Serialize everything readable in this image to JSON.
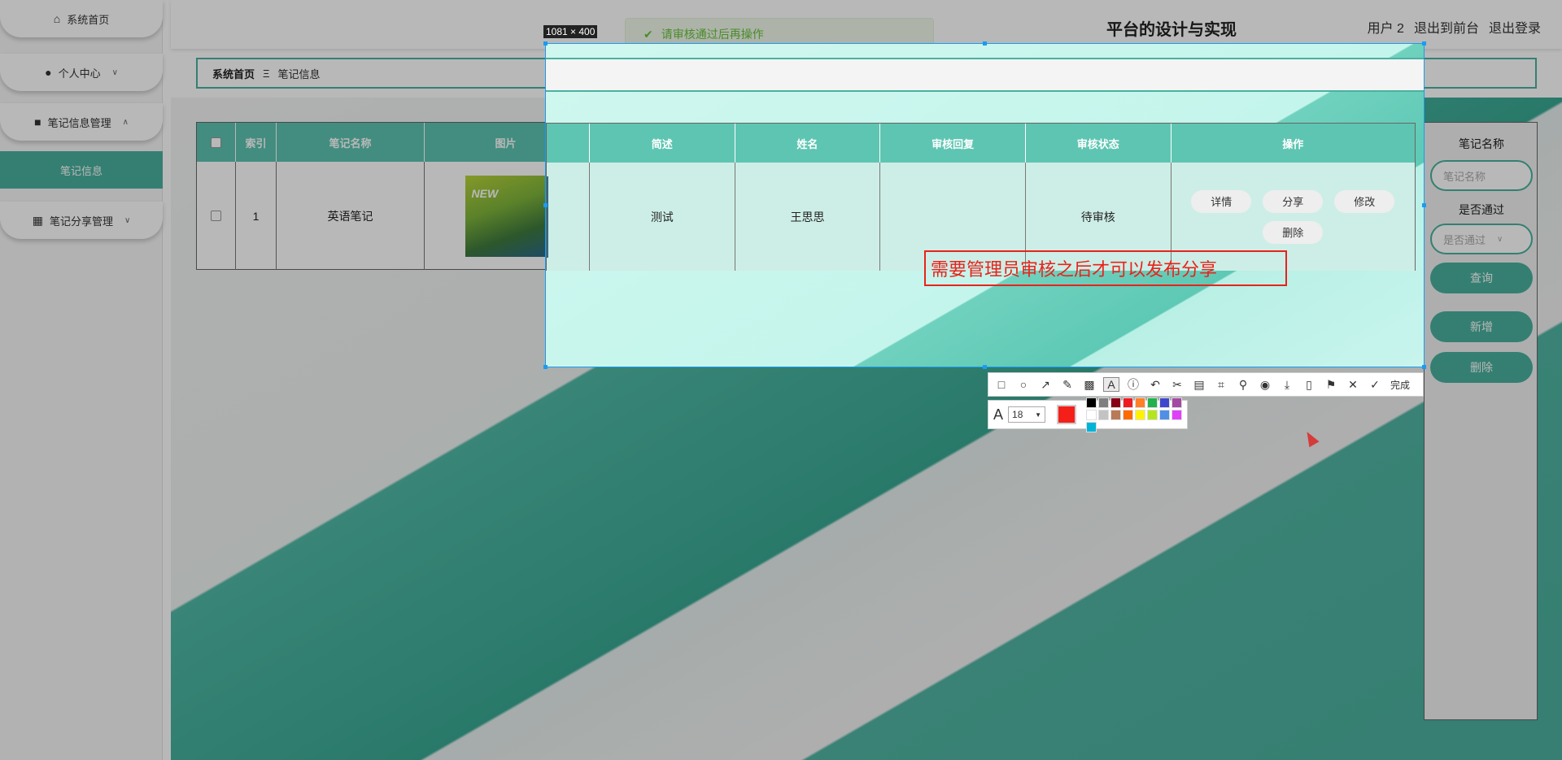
{
  "sidebar": {
    "items": [
      {
        "label": "系统首页",
        "icon": "home-icon"
      },
      {
        "label": "个人中心",
        "icon": "user-icon"
      },
      {
        "label": "笔记信息管理",
        "icon": "briefcase-icon"
      },
      {
        "label": "笔记分享管理",
        "icon": "grid-icon"
      }
    ],
    "active_sub": "笔记信息"
  },
  "header": {
    "title": "平台的设计与实现",
    "user": "用户 2",
    "back_to_front": "退出到前台",
    "logout": "退出登录"
  },
  "toast": {
    "message": "请审核通过后再操作"
  },
  "breadcrumb": {
    "home": "系统首页",
    "separator": "Ξ",
    "current": "笔记信息"
  },
  "table": {
    "headers": [
      "",
      "索引",
      "笔记名称",
      "图片",
      "简述",
      "姓名",
      "审核回复",
      "审核状态",
      "操作"
    ],
    "rows": [
      {
        "index": "1",
        "name": "英语笔记",
        "thumb_text": "NEW",
        "summary": "测试",
        "person": "王思思",
        "reply": "",
        "status": "待审核"
      }
    ],
    "actions": [
      "详情",
      "分享",
      "修改",
      "删除"
    ]
  },
  "filter": {
    "name_label": "笔记名称",
    "name_placeholder": "笔记名称",
    "pass_label": "是否通过",
    "pass_placeholder": "是否通过",
    "search": "查询",
    "add": "新增",
    "delete": "删除"
  },
  "screenshot": {
    "size_label": "1081 × 400",
    "annotation": "需要管理员审核之后才可以发布分享",
    "font_size": "18",
    "done_label": "完成",
    "current_color": "#f41f18",
    "palette": [
      "#000000",
      "#7f7f7f",
      "#880015",
      "#ed1c24",
      "#ff7f27",
      "#22b14c",
      "#3f48cc",
      "#a349a4",
      "#ffffff",
      "#c3c3c3",
      "#b97a57",
      "#ff6a00",
      "#fff200",
      "#b5e61d",
      "#4f8fe6",
      "#e040fb",
      "#00b4d8"
    ]
  },
  "colors": {
    "accent": "#4ab19f",
    "header_teal": "#5cc4b1",
    "annotation_red": "#e8231b",
    "selection_blue": "#1a9cf0"
  }
}
